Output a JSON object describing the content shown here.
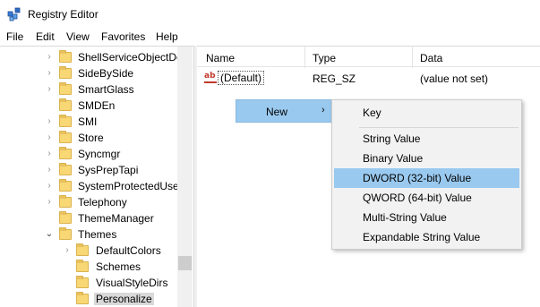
{
  "window": {
    "title": "Registry Editor"
  },
  "menubar": {
    "items": [
      "File",
      "Edit",
      "View",
      "Favorites",
      "Help"
    ]
  },
  "tree": {
    "items": [
      {
        "label": "ShellServiceObjectDe",
        "expander": "closed"
      },
      {
        "label": "SideBySide",
        "expander": "closed"
      },
      {
        "label": "SmartGlass",
        "expander": "closed"
      },
      {
        "label": "SMDEn",
        "expander": "none"
      },
      {
        "label": "SMI",
        "expander": "closed"
      },
      {
        "label": "Store",
        "expander": "closed"
      },
      {
        "label": "Syncmgr",
        "expander": "closed"
      },
      {
        "label": "SysPrepTapi",
        "expander": "closed"
      },
      {
        "label": "SystemProtectedUser",
        "expander": "closed"
      },
      {
        "label": "Telephony",
        "expander": "closed"
      },
      {
        "label": "ThemeManager",
        "expander": "none"
      },
      {
        "label": "Themes",
        "expander": "open"
      },
      {
        "label": "DefaultColors",
        "expander": "closed"
      },
      {
        "label": "Schemes",
        "expander": "none"
      },
      {
        "label": "VisualStyleDirs",
        "expander": "none"
      },
      {
        "label": "Personalize",
        "expander": "none",
        "selected": true
      }
    ]
  },
  "values_list": {
    "columns": {
      "name": "Name",
      "type": "Type",
      "data": "Data"
    },
    "rows": [
      {
        "icon": "ab",
        "name": "(Default)",
        "type": "REG_SZ",
        "data": "(value not set)"
      }
    ]
  },
  "context_menu": {
    "new_label": "New",
    "new_arrow": "›",
    "submenu": {
      "items": [
        "Key",
        "String Value",
        "Binary Value",
        "DWORD (32-bit) Value",
        "QWORD (64-bit) Value",
        "Multi-String Value",
        "Expandable String Value"
      ],
      "highlighted": "DWORD (32-bit) Value"
    }
  },
  "colors": {
    "highlight": "#99c9ef",
    "folder": "#f8d775",
    "menu_background": "#f2f2f2"
  }
}
